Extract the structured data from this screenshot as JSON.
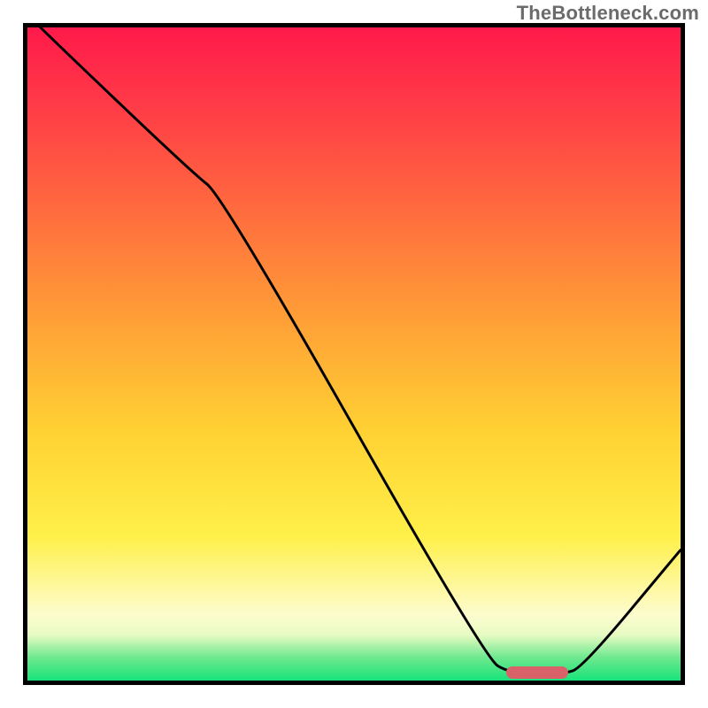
{
  "watermark": "TheBottleneck.com",
  "chart_data": {
    "type": "line",
    "x": [
      0.0,
      0.04,
      0.25,
      0.3,
      0.7,
      0.74,
      0.82,
      0.85,
      1.0
    ],
    "y": [
      1.02,
      0.98,
      0.78,
      0.74,
      0.035,
      0.01,
      0.01,
      0.02,
      0.2
    ],
    "marker": {
      "x_center": 0.78,
      "y": 0.012,
      "width": 0.095
    },
    "xlim": [
      0,
      1
    ],
    "ylim": [
      0,
      1
    ],
    "title": "",
    "xlabel": "",
    "ylabel": "",
    "note": "x and y are normalized fractions of the plot area; the curve dips to a minimum near x≈0.78 where a short pink marker sits, then rises toward the right edge."
  }
}
